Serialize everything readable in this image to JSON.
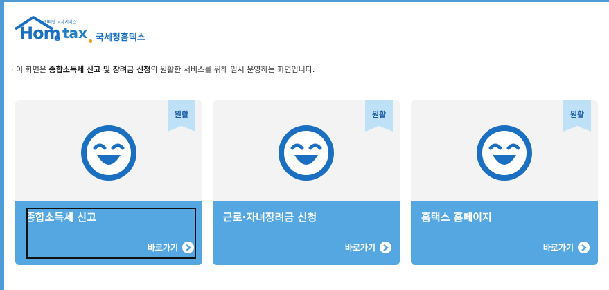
{
  "logo": {
    "tagline": "인터넷 납세서비스",
    "home": "Hom",
    "e": "e",
    "tax": "tax",
    "korean": "국세청홈택스"
  },
  "notice": {
    "prefix": "· 이 화면은 ",
    "bold1": "종합소득세 신고 및 장려금 신청",
    "suffix": "의 원활한 서비스를 위해 임시 운영하는 화면입니다."
  },
  "cards": [
    {
      "status": "원활",
      "title": "종합소득세 신고",
      "link": "바로가기"
    },
    {
      "status": "원활",
      "title": "근로·자녀장려금 신청",
      "link": "바로가기"
    },
    {
      "status": "원활",
      "title": "홈택스 홈페이지",
      "link": "바로가기"
    }
  ],
  "colors": {
    "accent": "#54a7e1",
    "face": "#1b6fc0",
    "ribbon": "#bfe1f7"
  }
}
